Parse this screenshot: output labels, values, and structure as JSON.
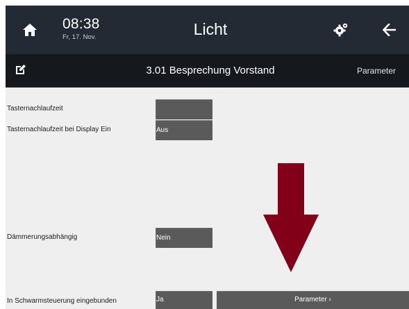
{
  "header": {
    "time": "08:38",
    "date": "Fr, 17. Nov.",
    "title": "Licht",
    "home_icon": "home-icon",
    "settings_icon": "gear-icon",
    "back_icon": "arrow-left-icon"
  },
  "subheader": {
    "room": "3.01 Besprechung Vorstand",
    "param_label": "Parameter",
    "edit_icon": "edit-icon"
  },
  "rows": [
    {
      "label": "Tasternachlaufzeit",
      "value": ""
    },
    {
      "label": "Tasternachlaufzeit bei Display Ein",
      "value": "Aus"
    },
    {
      "label": "Dämmerungsabhängig",
      "value": "Nein"
    },
    {
      "label": "In Schwarmsteuerung eingebunden",
      "value": "Ja"
    }
  ],
  "parameter_button": "Parameter ›",
  "overlay": {
    "icon": "arrow-down-icon",
    "color": "#820018"
  },
  "colors": {
    "topbar": "#242a33",
    "subbar": "#15181d",
    "field": "#5a5a5a",
    "background": "#efefef"
  }
}
